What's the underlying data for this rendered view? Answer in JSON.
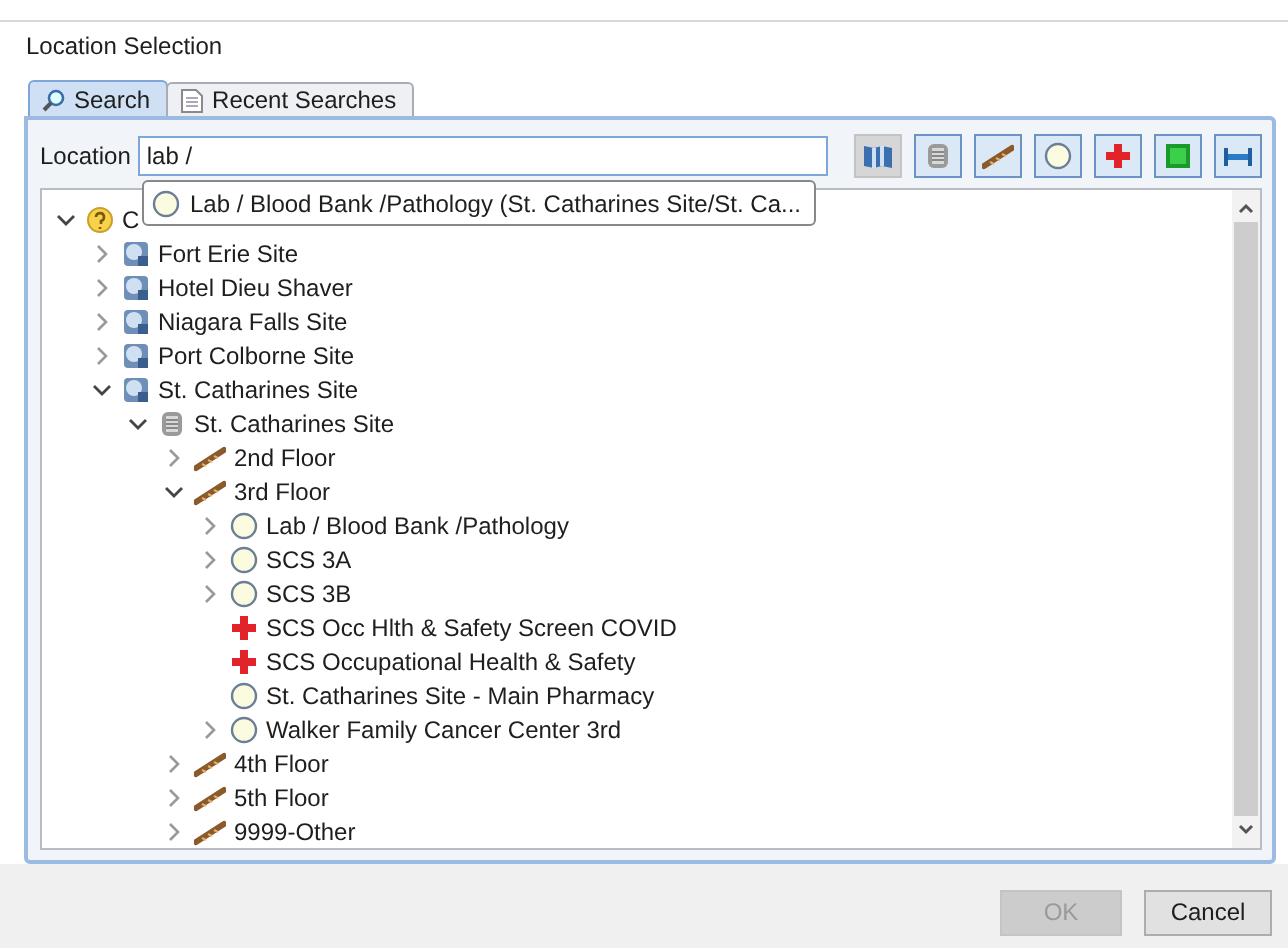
{
  "window": {
    "title": "Location Selection"
  },
  "tabs": [
    {
      "kind": "search",
      "label": "Search",
      "selected": true
    },
    {
      "kind": "history",
      "label": "Recent Searches",
      "selected": false
    }
  ],
  "location": {
    "label": "Location",
    "value": "lab /"
  },
  "filter_buttons": [
    {
      "kind": "site",
      "selected": true
    },
    {
      "kind": "building",
      "selected": false
    },
    {
      "kind": "floor",
      "selected": false
    },
    {
      "kind": "unit",
      "selected": false
    },
    {
      "kind": "health",
      "selected": false
    },
    {
      "kind": "room",
      "selected": false
    },
    {
      "kind": "bed",
      "selected": false
    }
  ],
  "suggestion": {
    "kind": "unit",
    "text": "Lab / Blood Bank /Pathology (St. Catharines Site/St. Ca..."
  },
  "tree": [
    {
      "kind": "root",
      "label": "C",
      "expanded": true,
      "children": [
        {
          "kind": "site",
          "label": "Fort Erie Site",
          "expanded": false
        },
        {
          "kind": "site",
          "label": "Hotel Dieu Shaver",
          "expanded": false
        },
        {
          "kind": "site",
          "label": "Niagara Falls Site",
          "expanded": false
        },
        {
          "kind": "site",
          "label": "Port Colborne Site",
          "expanded": false
        },
        {
          "kind": "site",
          "label": "St. Catharines Site",
          "expanded": true,
          "children": [
            {
              "kind": "building",
              "label": "St. Catharines Site",
              "expanded": true,
              "children": [
                {
                  "kind": "floor",
                  "label": "2nd Floor",
                  "expanded": false
                },
                {
                  "kind": "floor",
                  "label": "3rd Floor",
                  "expanded": true,
                  "children": [
                    {
                      "kind": "unit",
                      "label": "Lab / Blood Bank /Pathology",
                      "expanded": false
                    },
                    {
                      "kind": "unit",
                      "label": "SCS 3A",
                      "expanded": false
                    },
                    {
                      "kind": "unit",
                      "label": "SCS 3B",
                      "expanded": false
                    },
                    {
                      "kind": "health",
                      "label": "SCS Occ Hlth & Safety Screen COVID"
                    },
                    {
                      "kind": "health",
                      "label": "SCS Occupational Health & Safety"
                    },
                    {
                      "kind": "unit",
                      "label": "St. Catharines Site - Main Pharmacy"
                    },
                    {
                      "kind": "unit",
                      "label": "Walker Family Cancer Center 3rd",
                      "expanded": false
                    }
                  ]
                },
                {
                  "kind": "floor",
                  "label": "4th Floor",
                  "expanded": false
                },
                {
                  "kind": "floor",
                  "label": "5th Floor",
                  "expanded": false
                },
                {
                  "kind": "floor",
                  "label": "9999-Other",
                  "expanded": false
                }
              ]
            }
          ]
        }
      ]
    }
  ],
  "buttons": [
    {
      "label": "OK",
      "disabled": true
    },
    {
      "label": "Cancel",
      "disabled": false
    }
  ]
}
